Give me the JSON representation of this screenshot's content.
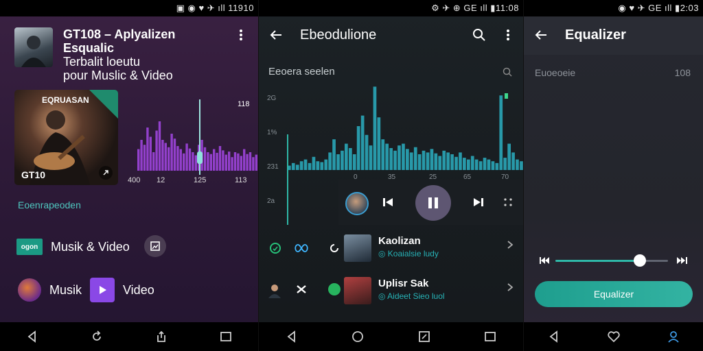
{
  "colors": {
    "accent_teal": "#2fb8a8",
    "accent_purple": "#a548e6",
    "panel1_bg": "#2e1a38",
    "panel2_bg": "#15191c",
    "panel3_bg": "#262830"
  },
  "panel1": {
    "status_text": "▣ ◉ ♥ ✈ ıll 11910",
    "title_line1": "GT108 – Aplyalizen Esqualic",
    "title_line2": "Terbalit loeutu",
    "title_line3": "pour Muslic & Video",
    "album_label": "EQRUASAN",
    "album_code": "GT10",
    "eq_peak_label": "118",
    "eq_ticks": [
      "400",
      "12",
      "125",
      "113"
    ],
    "section_label": "Eoenrapeoden",
    "row1_badge": "ogon",
    "row1_label": "Musik & Video",
    "row2_label_a": "Musik",
    "row2_label_b": "Video",
    "eq_levels": [
      0.35,
      0.5,
      0.42,
      0.7,
      0.55,
      0.3,
      0.65,
      0.8,
      0.5,
      0.45,
      0.38,
      0.6,
      0.52,
      0.4,
      0.35,
      0.28,
      0.44,
      0.36,
      0.3,
      0.25,
      0.42,
      0.5,
      0.38,
      0.3,
      0.27,
      0.35,
      0.29,
      0.4,
      0.33,
      0.26,
      0.31,
      0.22,
      0.3,
      0.28,
      0.24,
      0.35,
      0.27,
      0.3,
      0.22,
      0.26
    ]
  },
  "panel2": {
    "status_text": "⚙ ✈ ⊕ GE ıll ▮11:08",
    "toolbar_title": "Ebeodulione",
    "subheader": "Eeoera seelen",
    "y_labels": [
      "2G",
      "1%",
      "231",
      "2a"
    ],
    "x_labels": [
      "0",
      "35",
      "25",
      "65",
      "70"
    ],
    "spectrum": [
      0.05,
      0.08,
      0.06,
      0.1,
      0.12,
      0.08,
      0.15,
      0.1,
      0.09,
      0.12,
      0.2,
      0.35,
      0.18,
      0.22,
      0.3,
      0.25,
      0.18,
      0.5,
      0.62,
      0.4,
      0.28,
      0.95,
      0.6,
      0.35,
      0.3,
      0.25,
      0.22,
      0.28,
      0.3,
      0.24,
      0.2,
      0.26,
      0.18,
      0.22,
      0.2,
      0.24,
      0.19,
      0.16,
      0.22,
      0.2,
      0.18,
      0.15,
      0.2,
      0.14,
      0.12,
      0.16,
      0.12,
      0.1,
      0.14,
      0.12,
      0.1,
      0.08,
      0.85,
      0.14,
      0.3,
      0.2,
      0.12,
      0.1
    ],
    "list": [
      {
        "title": "Kaolizan",
        "subtitle": "◎ Koaialsie ludy"
      },
      {
        "title": "Uplisr Sak",
        "subtitle": "◎ Aideet Sieo luol"
      }
    ]
  },
  "panel3": {
    "status_text": "◉ ♥ ✈ GE ıll ▮2:03",
    "title": "Equalizer",
    "setting_label": "Euoeoeie",
    "setting_value": "108",
    "slider_value": 0.75,
    "button_label": "Equalizer"
  }
}
